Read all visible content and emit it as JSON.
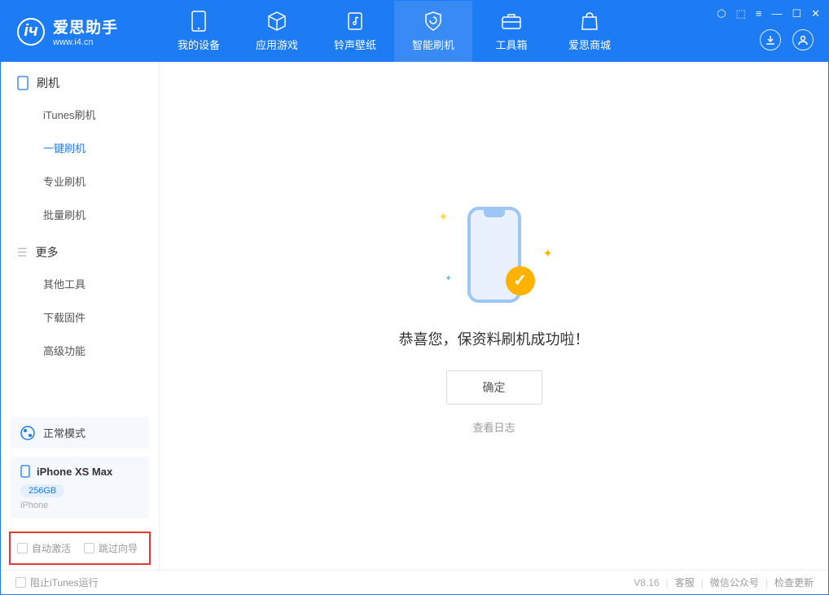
{
  "app": {
    "title": "爱思助手",
    "url": "www.i4.cn"
  },
  "nav": {
    "my_device": "我的设备",
    "apps_games": "应用游戏",
    "ringtones": "铃声壁纸",
    "smart_flash": "智能刷机",
    "toolbox": "工具箱",
    "store": "爱思商城"
  },
  "sidebar": {
    "flash_section": "刷机",
    "items": {
      "itunes_flash": "iTunes刷机",
      "one_key_flash": "一键刷机",
      "pro_flash": "专业刷机",
      "batch_flash": "批量刷机"
    },
    "more_section": "更多",
    "more_items": {
      "other_tools": "其他工具",
      "download_fw": "下载固件",
      "advanced": "高级功能"
    },
    "mode_status": "正常模式",
    "device": {
      "name": "iPhone XS Max",
      "capacity": "256GB",
      "type": "iPhone"
    },
    "auto_activate": "自动激活",
    "skip_guide": "跳过向导"
  },
  "main": {
    "success_message": "恭喜您，保资料刷机成功啦！",
    "ok_button": "确定",
    "view_log": "查看日志"
  },
  "footer": {
    "block_itunes": "阻止iTunes运行",
    "version": "V8.16",
    "support": "客服",
    "wechat": "微信公众号",
    "check_update": "检查更新"
  }
}
